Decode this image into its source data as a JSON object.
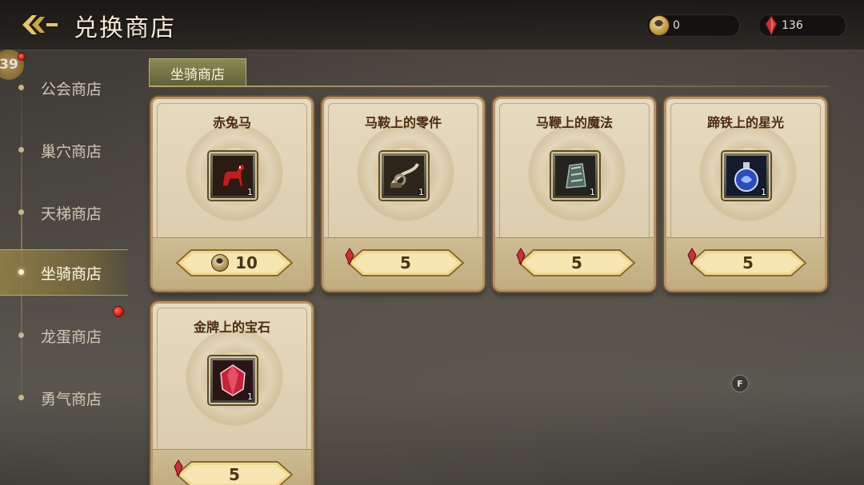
{
  "header": {
    "title": "兑换商店",
    "back_icon": "back-arrow-icon",
    "currencies": [
      {
        "icon": "coin-token-icon",
        "value": "0"
      },
      {
        "icon": "red-crystal-icon",
        "value": "136"
      }
    ]
  },
  "sidebar": {
    "level_badge": "39",
    "items": [
      {
        "label": "公会商店",
        "active": false,
        "notice": true
      },
      {
        "label": "巢穴商店",
        "active": false,
        "notice": false
      },
      {
        "label": "天梯商店",
        "active": false,
        "notice": false
      },
      {
        "label": "坐骑商店",
        "active": true,
        "notice": false
      },
      {
        "label": "龙蛋商店",
        "active": false,
        "notice": true
      },
      {
        "label": "勇气商店",
        "active": false,
        "notice": false
      }
    ]
  },
  "tab": {
    "label": "坐骑商店"
  },
  "items": [
    {
      "name": "赤兔马",
      "icon": "red-horse-icon",
      "qty": "1",
      "price": "10",
      "currency": "coin-token-icon"
    },
    {
      "name": "马鞍上的零件",
      "icon": "saddle-part-icon",
      "qty": "1",
      "price": "5",
      "currency": "red-crystal-icon"
    },
    {
      "name": "马鞭上的魔法",
      "icon": "whip-magic-icon",
      "qty": "1",
      "price": "5",
      "currency": "red-crystal-icon"
    },
    {
      "name": "蹄铁上的星光",
      "icon": "starlight-potion-icon",
      "qty": "1",
      "price": "5",
      "currency": "red-crystal-icon"
    },
    {
      "name": "金牌上的宝石",
      "icon": "red-gem-icon",
      "qty": "1",
      "price": "5",
      "currency": "red-crystal-icon"
    }
  ],
  "floating_badge": "F",
  "colors": {
    "accent_gold": "#e9c779",
    "notice_red": "#d41a10",
    "card_bg": "#e2d5b8"
  }
}
